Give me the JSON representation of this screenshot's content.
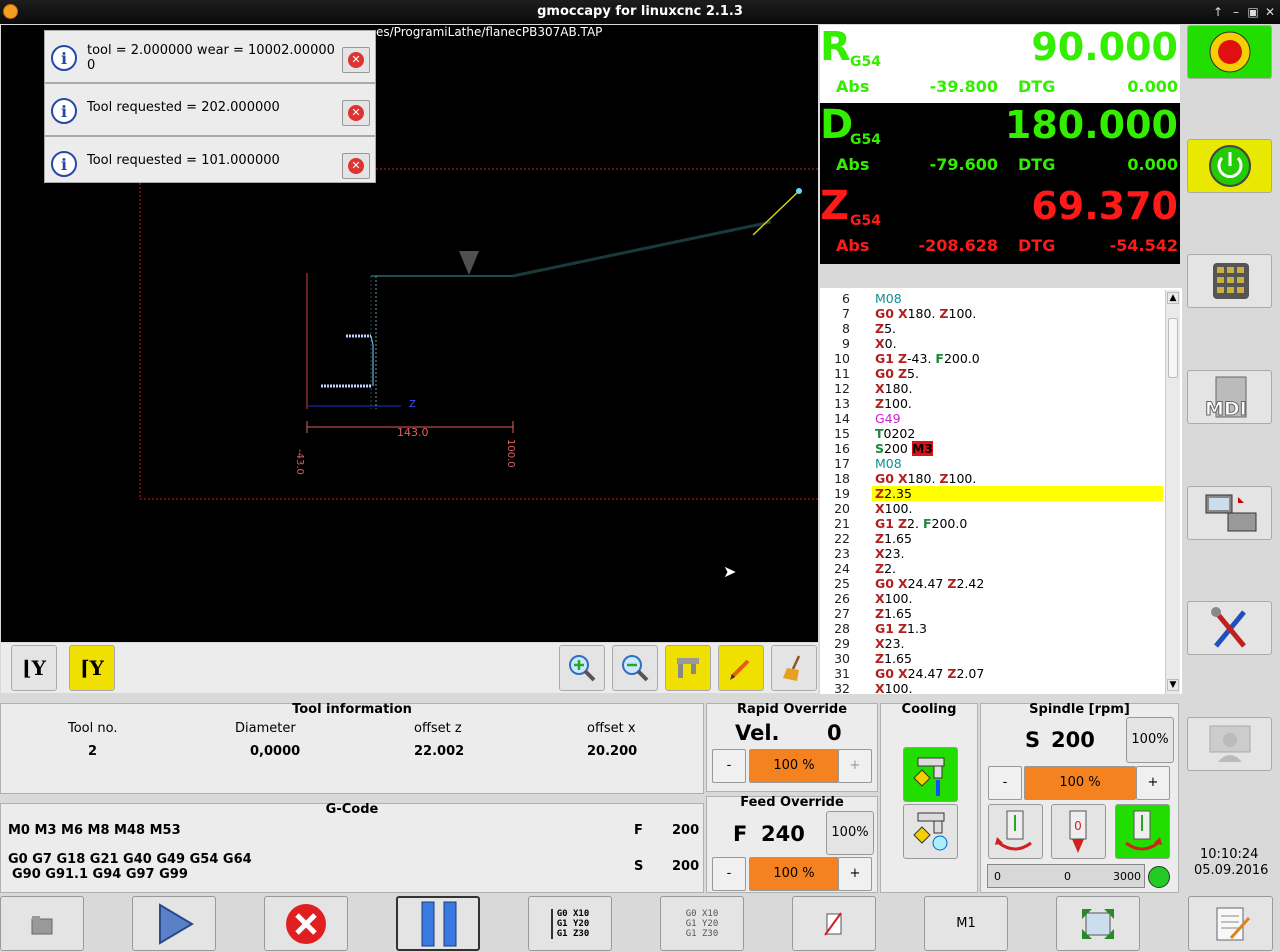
{
  "window": {
    "title": "gmoccapy for linuxcnc  2.1.3",
    "controls": [
      "↑",
      "–",
      "▣",
      "✕"
    ]
  },
  "preview": {
    "file": "es/ProgramiLathe/flanecPB307AB.TAP",
    "dim_width": "143.0",
    "dim_left": "-43.0",
    "dim_right": "100.0",
    "axis_label": "Z"
  },
  "messages": [
    {
      "line1": "tool = 2.000000 wear = 10002.00000",
      "line2": "0"
    },
    {
      "line1": "Tool requested = 202.000000",
      "line2": ""
    },
    {
      "line1": "Tool requested = 101.000000",
      "line2": ""
    }
  ],
  "dro": [
    {
      "axis": "R",
      "system": "G54",
      "value": "90.000",
      "abs_label": "Abs",
      "abs": "-39.800",
      "dtg_label": "DTG",
      "dtg": "0.000",
      "color": "#33ee00"
    },
    {
      "axis": "D",
      "system": "G54",
      "value": "180.000",
      "abs_label": "Abs",
      "abs": "-79.600",
      "dtg_label": "DTG",
      "dtg": "0.000",
      "color": "#33ee00"
    },
    {
      "axis": "Z",
      "system": "G54",
      "value": "69.370",
      "abs_label": "Abs",
      "abs": "-208.628",
      "dtg_label": "DTG",
      "dtg": "-54.542",
      "color": "#ff1a1a"
    }
  ],
  "gcode_lines": [
    {
      "n": "6",
      "code": "M08"
    },
    {
      "n": "7",
      "code": "G0 X180. Z100."
    },
    {
      "n": "8",
      "code": "Z5."
    },
    {
      "n": "9",
      "code": "X0."
    },
    {
      "n": "10",
      "code": "G1 Z-43. F200.0"
    },
    {
      "n": "11",
      "code": "G0 Z5."
    },
    {
      "n": "12",
      "code": "X180."
    },
    {
      "n": "13",
      "code": "Z100."
    },
    {
      "n": "14",
      "code": "G49"
    },
    {
      "n": "15",
      "code": "T0202"
    },
    {
      "n": "16",
      "code": "S200 M3"
    },
    {
      "n": "17",
      "code": "M08"
    },
    {
      "n": "18",
      "code": "G0 X180. Z100."
    },
    {
      "n": "19",
      "code": "Z2.35"
    },
    {
      "n": "20",
      "code": "X100."
    },
    {
      "n": "21",
      "code": "G1 Z2. F200.0"
    },
    {
      "n": "22",
      "code": "Z1.65"
    },
    {
      "n": "23",
      "code": "X23."
    },
    {
      "n": "24",
      "code": "Z2."
    },
    {
      "n": "25",
      "code": "G0 X24.47 Z2.42"
    },
    {
      "n": "26",
      "code": "X100."
    },
    {
      "n": "27",
      "code": "Z1.65"
    },
    {
      "n": "28",
      "code": "G1 Z1.3"
    },
    {
      "n": "29",
      "code": "X23."
    },
    {
      "n": "30",
      "code": "Z1.65"
    },
    {
      "n": "31",
      "code": "G0 X24.47 Z2.07"
    },
    {
      "n": "32",
      "code": "X100."
    }
  ],
  "current_line": "19",
  "tool_info": {
    "title": "Tool information",
    "h_tool": "Tool no.",
    "h_diam": "Diameter",
    "h_oz": "offset z",
    "h_ox": "offset x",
    "tool": "2",
    "diam": "0,0000",
    "oz": "22.002",
    "ox": "20.200"
  },
  "rapid": {
    "title": "Rapid Override",
    "vel_label": "Vel.",
    "vel": "0",
    "percent": "100 %",
    "fill": 1.0,
    "minus": "-",
    "plus": "+"
  },
  "feed": {
    "title": "Feed Override",
    "f_label": "F",
    "f": "240",
    "reset": "100%",
    "percent": "100 %",
    "fill": 1.0,
    "minus": "-",
    "plus": "+"
  },
  "cooling": {
    "title": "Cooling"
  },
  "spindle": {
    "title": "Spindle [rpm]",
    "s_label": "S",
    "s": "200",
    "reset": "100%",
    "percent": "100 %",
    "minus": "-",
    "plus": "+",
    "bar_min": "0",
    "bar_val": "0",
    "bar_max": "3000"
  },
  "gcode_info": {
    "title": "G-Code",
    "mcodes": "M0 M3 M6 M8 M48 M53",
    "gcodes1": "G0 G7 G18 G21 G40 G49 G54 G64",
    "gcodes2": "G90 G91.1 G94 G97 G99",
    "f_label": "F",
    "f": "200",
    "s_label": "S",
    "s": "200"
  },
  "clock": {
    "time": "10:10:24",
    "date": "05.09.2016"
  },
  "bottom": {
    "m1": "M1",
    "gx1": "G0  X10",
    "gx2": "G1  Y20",
    "gx3": "G1  Z30"
  },
  "side": {
    "mdi": "MDI"
  },
  "colors": {
    "orange": "#f58220",
    "green": "#22dd00"
  }
}
